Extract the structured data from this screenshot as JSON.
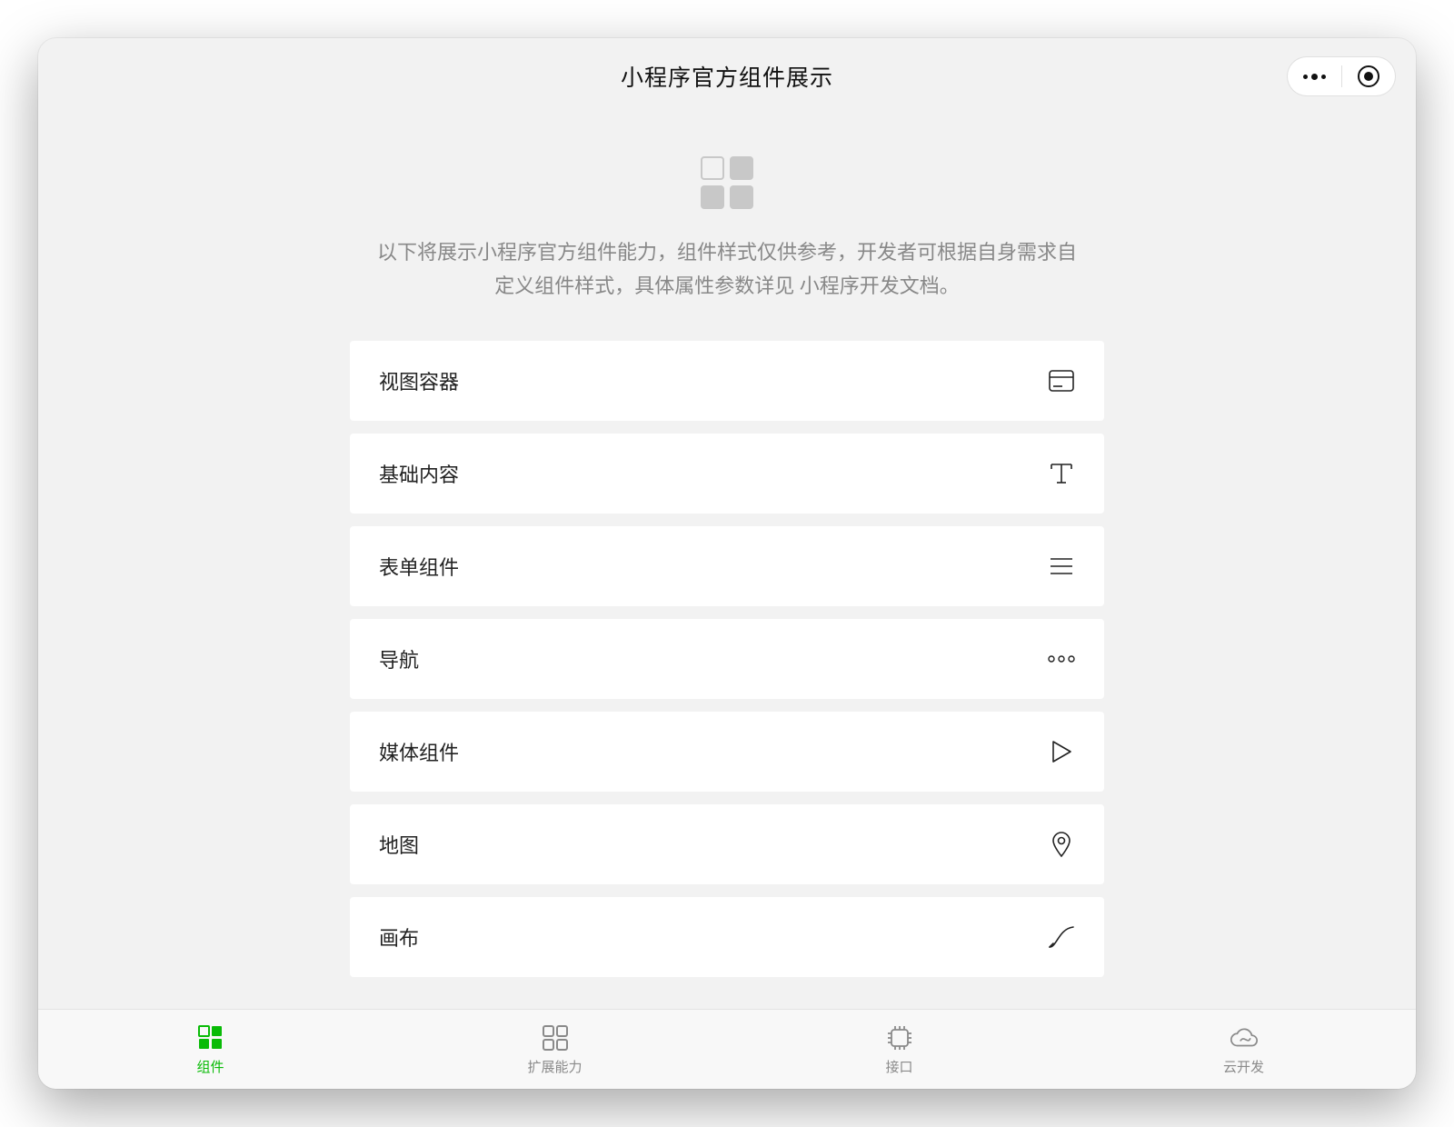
{
  "header": {
    "title": "小程序官方组件展示"
  },
  "intro": {
    "text_part1": "以下将展示小程序官方组件能力，组件样式仅供参考，开发者可根据自身需求自定义组件样式，具体属性参数详见 ",
    "link_text": "小程序开发文档",
    "text_part2": "。"
  },
  "list": {
    "items": [
      {
        "label": "视图容器",
        "icon": "card-icon"
      },
      {
        "label": "基础内容",
        "icon": "text-icon"
      },
      {
        "label": "表单组件",
        "icon": "list-lines-icon"
      },
      {
        "label": "导航",
        "icon": "dots-horizontal-icon"
      },
      {
        "label": "媒体组件",
        "icon": "play-icon"
      },
      {
        "label": "地图",
        "icon": "location-pin-icon"
      },
      {
        "label": "画布",
        "icon": "curve-icon"
      }
    ]
  },
  "tabbar": {
    "items": [
      {
        "label": "组件",
        "active": true
      },
      {
        "label": "扩展能力",
        "active": false
      },
      {
        "label": "接口",
        "active": false
      },
      {
        "label": "云开发",
        "active": false
      }
    ]
  }
}
